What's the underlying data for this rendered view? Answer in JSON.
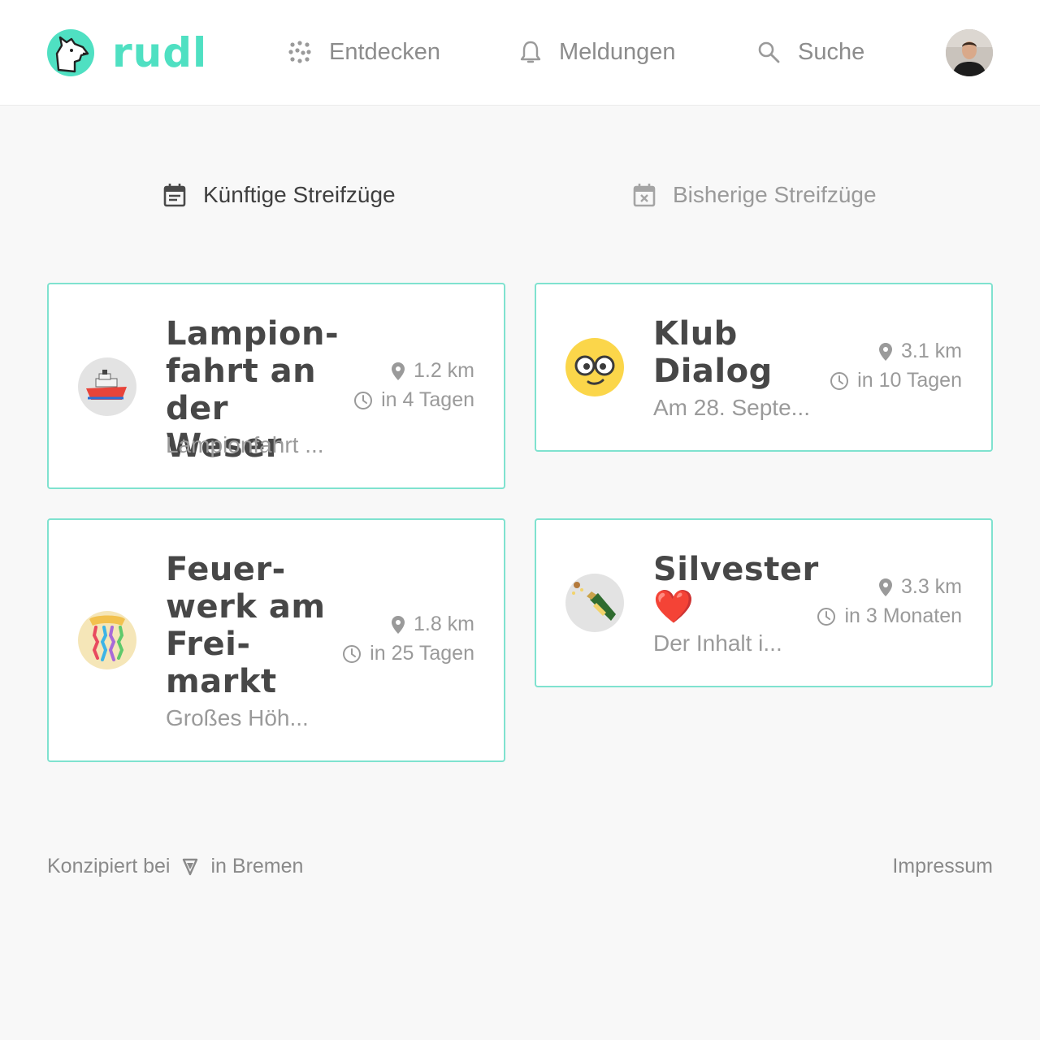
{
  "header": {
    "logo_text": "rudl",
    "nav": [
      {
        "label": "Entdecken",
        "icon": "dots-grid-icon"
      },
      {
        "label": "Meldungen",
        "icon": "bell-icon"
      },
      {
        "label": "Suche",
        "icon": "search-icon"
      }
    ],
    "accent_color": "#4fe0c2"
  },
  "tabs": [
    {
      "label": "Künftige Streifzüge",
      "active": true,
      "icon": "calendar-icon"
    },
    {
      "label": "Bisherige Streifzüge",
      "active": false,
      "icon": "calendar-x-icon"
    }
  ],
  "events": [
    {
      "title": "Lampion-fahrt an der Weser",
      "description": "Lampionfahrt ...",
      "distance": "1.2 km",
      "time": "in 4 Tagen",
      "emoji": "ship-icon"
    },
    {
      "title": "Klub Dialog",
      "description": "Am 28. Septe...",
      "distance": "3.1 km",
      "time": "in 10 Tagen",
      "emoji": "nerd-face-icon"
    },
    {
      "title": "Feuer-werk am Frei-markt",
      "description": "Großes Höh...",
      "distance": "1.8 km",
      "time": "in 25 Tagen",
      "emoji": "confetti-icon"
    },
    {
      "title": "Silvester ❤️",
      "description": "Der Inhalt i...",
      "distance": "3.3 km",
      "time": "in 3 Monaten",
      "emoji": "champagne-icon"
    }
  ],
  "footer": {
    "left_prefix": "Konzipiert bei",
    "left_suffix": "in Bremen",
    "right_link": "Impressum"
  }
}
